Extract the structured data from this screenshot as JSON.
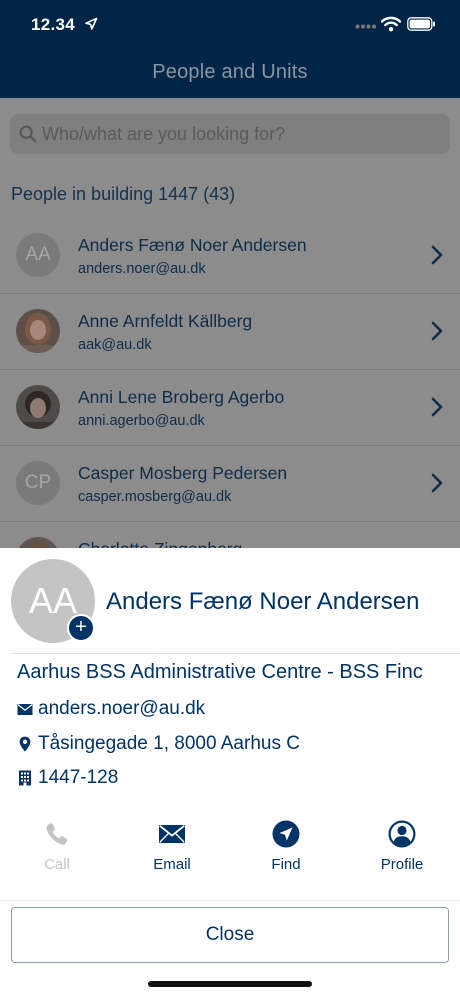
{
  "status_bar": {
    "time": "12.34"
  },
  "nav": {
    "title": "People and Units"
  },
  "search": {
    "placeholder": "Who/what are you looking for?"
  },
  "list": {
    "section_title": "People in building 1447 (43)",
    "items": [
      {
        "name": "Anders Fænø Noer Andersen",
        "email": "anders.noer@au.dk",
        "initials": "AA",
        "avatar": "initials"
      },
      {
        "name": "Anne Arnfeldt Källberg",
        "email": "aak@au.dk",
        "avatar": "photo",
        "photo_color": "#6e5a4e"
      },
      {
        "name": "Anni Lene Broberg Agerbo",
        "email": "anni.agerbo@au.dk",
        "avatar": "photo",
        "photo_color": "#4a3f39"
      },
      {
        "name": "Casper Mosberg Pedersen",
        "email": "casper.mosberg@au.dk",
        "initials": "CP",
        "avatar": "initials"
      },
      {
        "name": "Charlotte Zingenberg",
        "email": "",
        "avatar": "photo",
        "photo_color": "#6b5547"
      }
    ]
  },
  "sheet": {
    "initials": "AA",
    "name": "Anders Fænø Noer Andersen",
    "department": "Aarhus BSS Administrative Centre - BSS Finc",
    "email": "anders.noer@au.dk",
    "address": "Tåsingegade 1, 8000 Aarhus C",
    "room": "1447-128",
    "actions": [
      {
        "label": "Call",
        "icon": "phone-icon",
        "enabled": false
      },
      {
        "label": "Email",
        "icon": "envelope-icon",
        "enabled": true
      },
      {
        "label": "Find",
        "icon": "navigation-arrow-icon",
        "enabled": true
      },
      {
        "label": "Profile",
        "icon": "user-profile-icon",
        "enabled": true
      }
    ],
    "close_label": "Close"
  },
  "colors": {
    "navy": "#002546",
    "accent": "#003366",
    "disabled": "#c4c4c4"
  }
}
